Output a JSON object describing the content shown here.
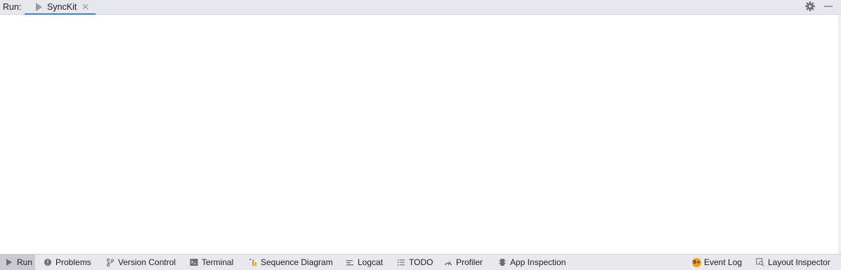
{
  "run_panel": {
    "label": "Run:",
    "tab": {
      "title": "SyncKit",
      "icon": "play-icon"
    },
    "actions": [
      "settings-icon",
      "minimize-icon"
    ]
  },
  "tool_windows": {
    "left": [
      {
        "label": "Run",
        "icon": "run-icon",
        "active": true
      },
      {
        "label": "Problems",
        "icon": "problems-icon",
        "active": false
      },
      {
        "label": "Version Control",
        "icon": "version-control-icon",
        "active": false
      },
      {
        "label": "Terminal",
        "icon": "terminal-icon",
        "active": false
      },
      {
        "label": "Sequence Diagram",
        "icon": "sequence-diagram-icon",
        "active": false
      },
      {
        "label": "Logcat",
        "icon": "logcat-icon",
        "active": false
      },
      {
        "label": "TODO",
        "icon": "todo-icon",
        "active": false
      },
      {
        "label": "Profiler",
        "icon": "profiler-icon",
        "active": false
      },
      {
        "label": "App Inspection",
        "icon": "app-inspection-icon",
        "active": false
      }
    ],
    "right": [
      {
        "label": "Event Log",
        "icon": "event-log-icon",
        "badge": "9+"
      },
      {
        "label": "Layout Inspector",
        "icon": "layout-inspector-icon"
      }
    ]
  },
  "colors": {
    "header_bg": "#e6e8ee",
    "tab_underline": "#3b7fd4",
    "bottom_bar_bg": "#e8e9ee",
    "active_tool_bg": "#c8cbd2",
    "badge": "#e9a21a"
  }
}
